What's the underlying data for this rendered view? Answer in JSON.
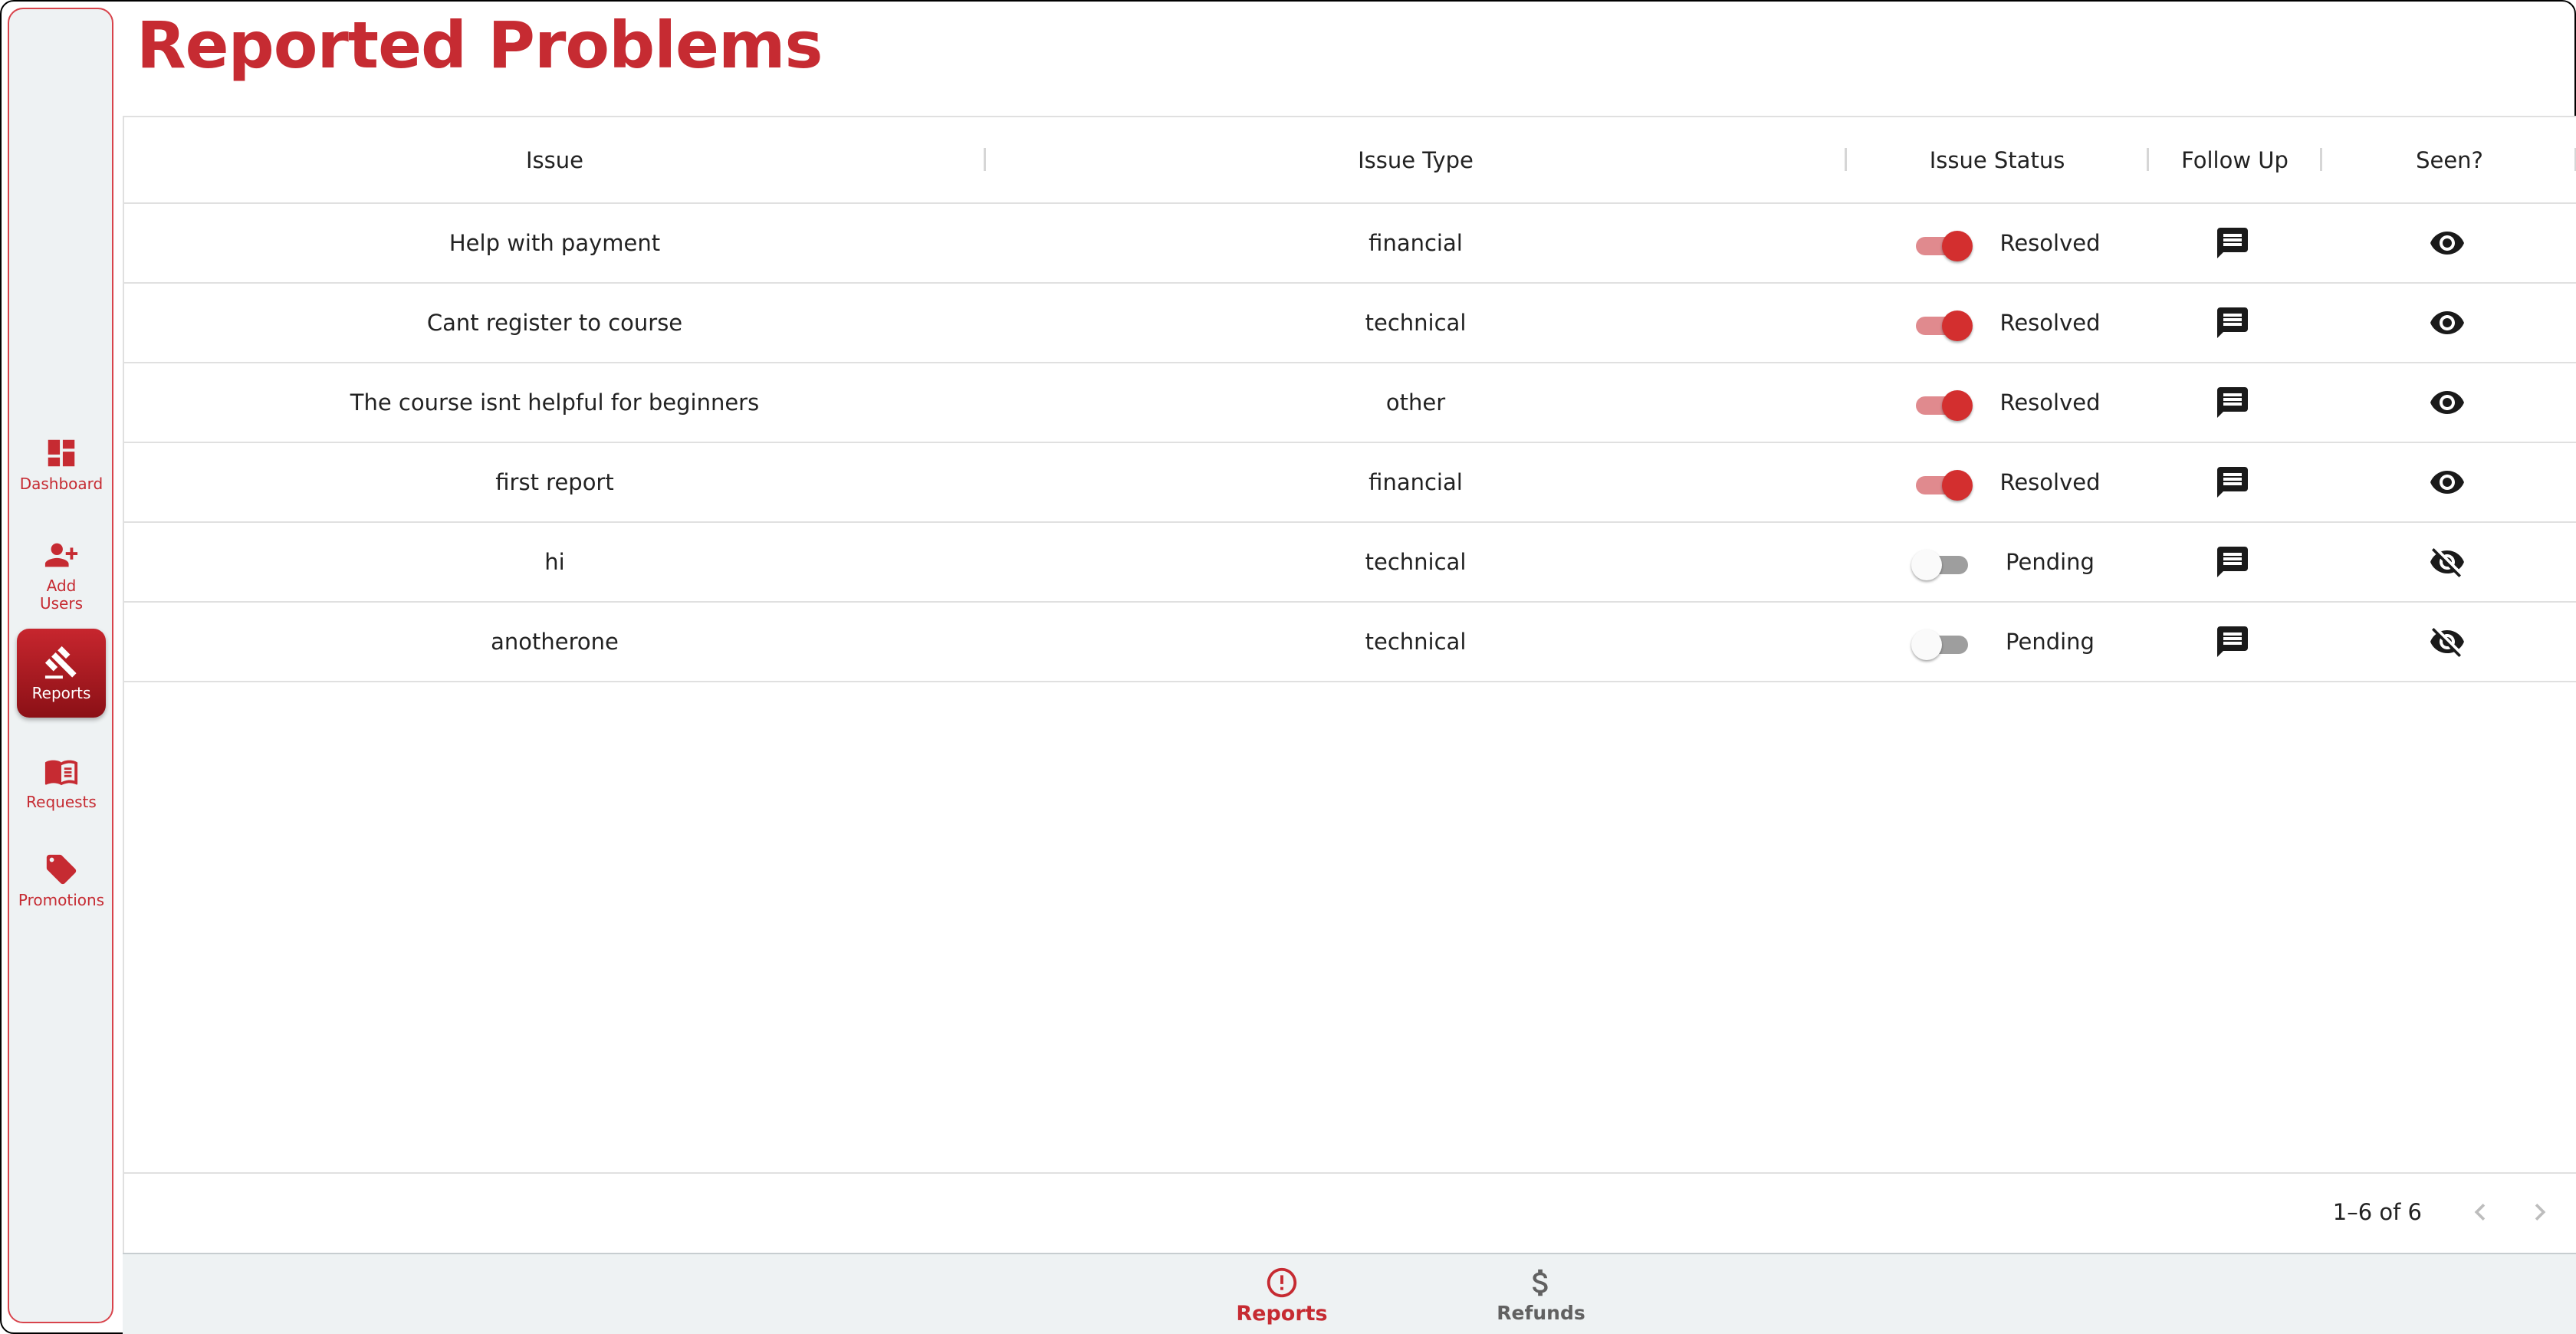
{
  "page": {
    "title": "Reported Problems"
  },
  "sidebar": {
    "items": [
      {
        "label": "Dashboard",
        "icon": "dashboard-icon",
        "active": false
      },
      {
        "label": "Add Users",
        "icon": "add-user-icon",
        "active": false
      },
      {
        "label": "Reports",
        "icon": "gavel-icon",
        "active": true
      },
      {
        "label": "Requests",
        "icon": "book-icon",
        "active": false
      },
      {
        "label": "Promotions",
        "icon": "tag-icon",
        "active": false
      }
    ]
  },
  "table": {
    "columns": [
      "Issue",
      "Issue Type",
      "Issue Status",
      "Follow Up",
      "Seen?"
    ],
    "rows": [
      {
        "issue": "Help with payment",
        "type": "financial",
        "status": "Resolved",
        "resolved": true,
        "seen": true
      },
      {
        "issue": "Cant register to course",
        "type": "technical",
        "status": "Resolved",
        "resolved": true,
        "seen": true
      },
      {
        "issue": "The course isnt helpful for beginners",
        "type": "other",
        "status": "Resolved",
        "resolved": true,
        "seen": true
      },
      {
        "issue": "first report",
        "type": "financial",
        "status": "Resolved",
        "resolved": true,
        "seen": true
      },
      {
        "issue": "hi",
        "type": "technical",
        "status": "Pending",
        "resolved": false,
        "seen": false
      },
      {
        "issue": "anotherone",
        "type": "technical",
        "status": "Pending",
        "resolved": false,
        "seen": false
      }
    ],
    "pagination": {
      "range": "1–6 of 6"
    }
  },
  "bottom_nav": {
    "items": [
      {
        "label": "Reports",
        "icon": "alert-circle-icon",
        "active": true
      },
      {
        "label": "Refunds",
        "icon": "dollar-icon",
        "active": false
      }
    ]
  },
  "colors": {
    "accent": "#c62b32",
    "sidebar_bg": "#eef2f3"
  }
}
